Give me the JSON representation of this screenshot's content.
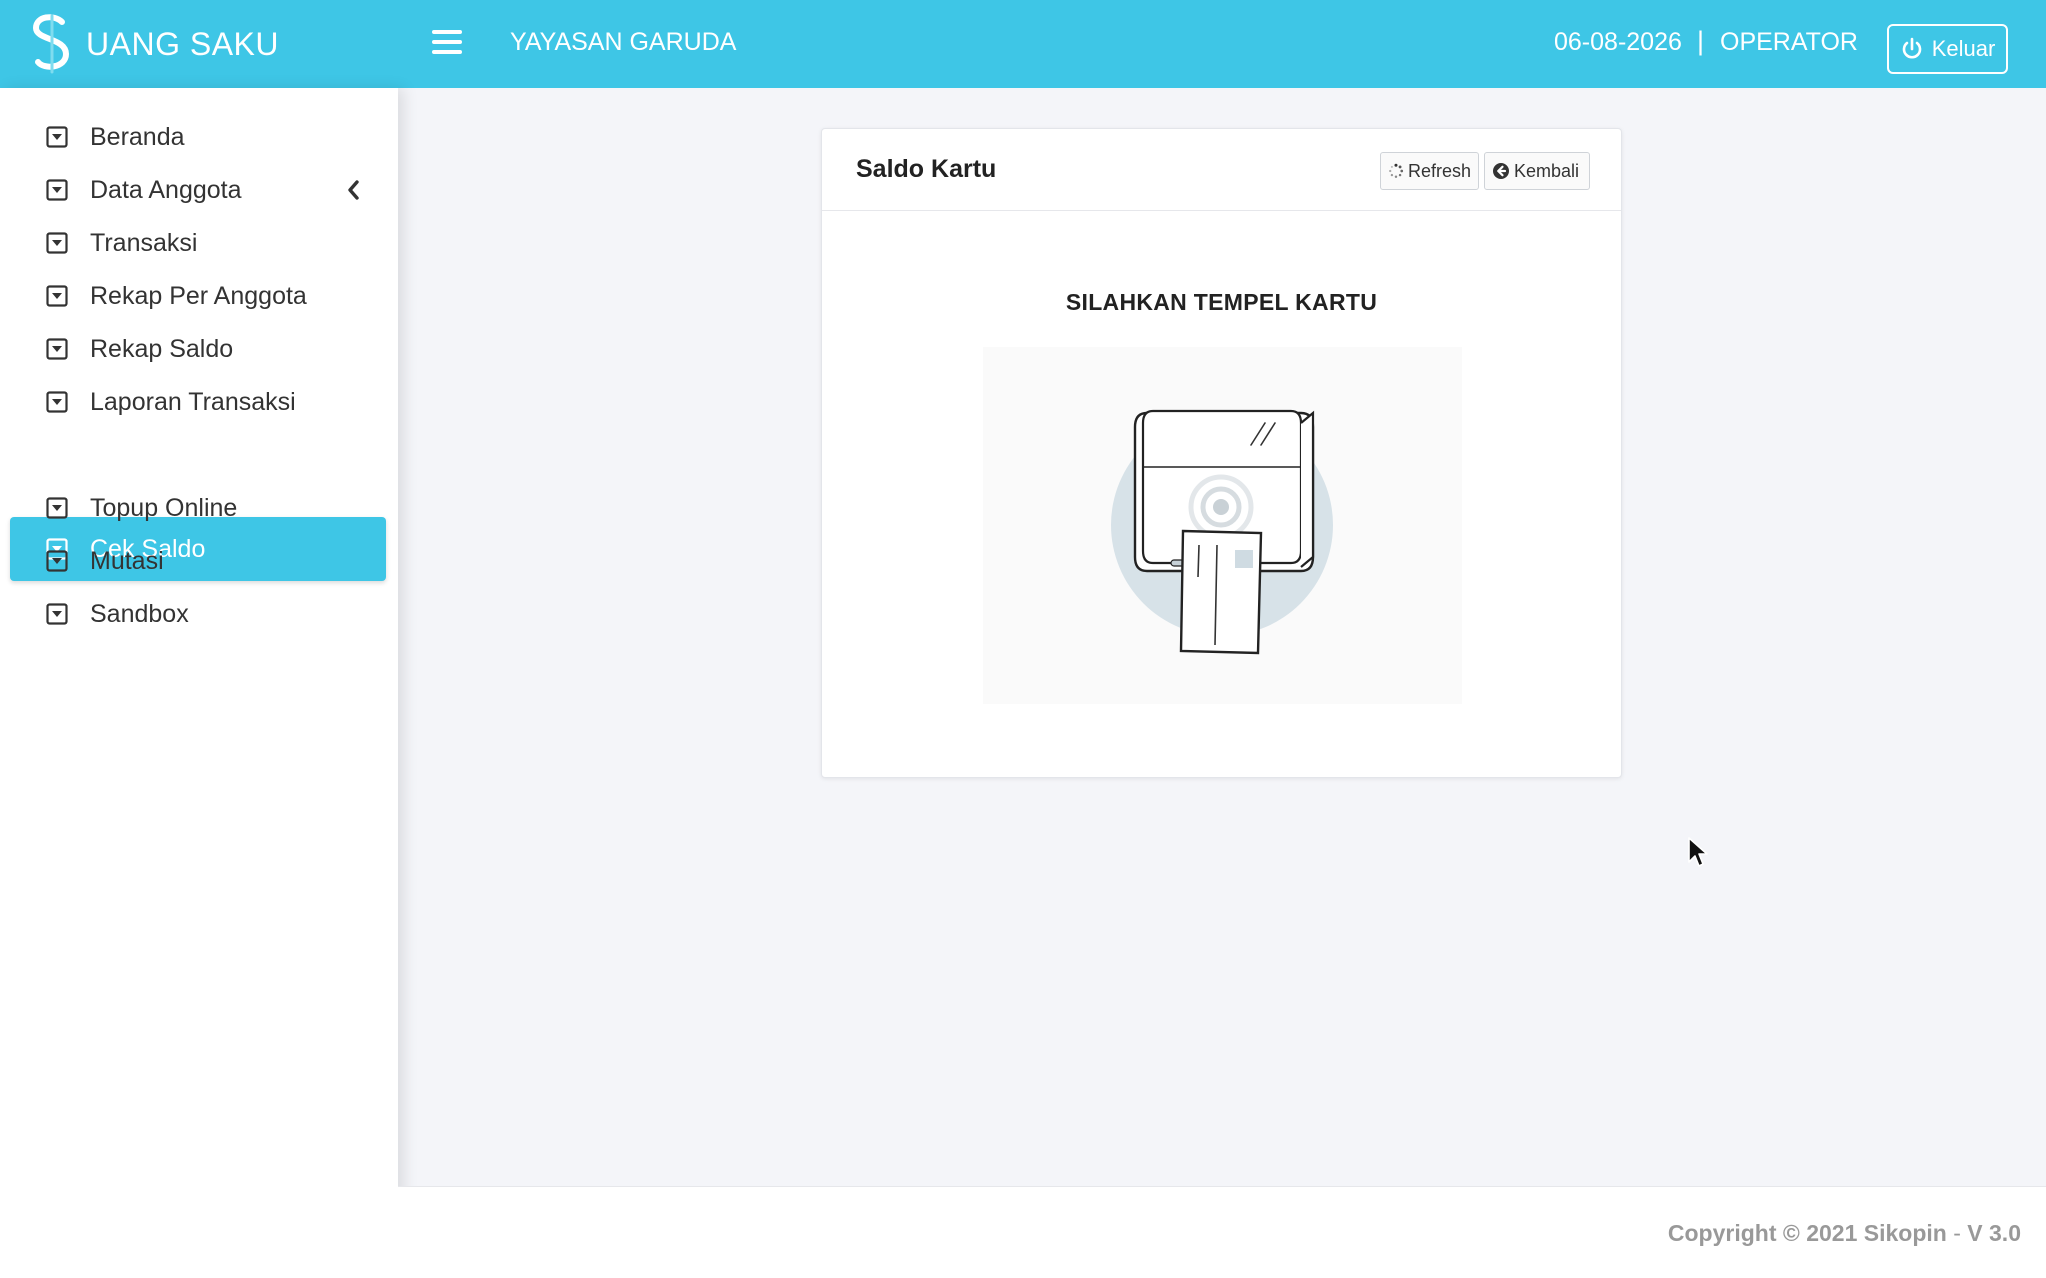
{
  "header": {
    "brand_name": "UANG SAKU",
    "org_name": "YAYASAN GARUDA",
    "date": "06-08-2026",
    "separator": "|",
    "role": "OPERATOR",
    "logout_label": "Keluar",
    "bg_color": "#3ec6e6"
  },
  "sidebar": {
    "items": [
      {
        "label": "Beranda",
        "icon": "caret-square-down-icon"
      },
      {
        "label": "Data Anggota",
        "icon": "caret-square-down-icon",
        "has_submenu": true
      },
      {
        "label": "Transaksi",
        "icon": "caret-square-down-icon"
      },
      {
        "label": "Rekap Per Anggota",
        "icon": "caret-square-down-icon"
      },
      {
        "label": "Rekap Saldo",
        "icon": "caret-square-down-icon"
      },
      {
        "label": "Laporan Transaksi",
        "icon": "caret-square-down-icon"
      },
      {
        "label": "Cek Saldo",
        "icon": "caret-square-down-icon",
        "active": true
      },
      {
        "label": "Topup Online",
        "icon": "caret-square-down-icon"
      },
      {
        "label": "Mutasi",
        "icon": "caret-square-down-icon"
      },
      {
        "label": "Sandbox",
        "icon": "caret-square-down-icon"
      }
    ],
    "active_color": "#3ec6e6"
  },
  "card": {
    "title": "Saldo Kartu",
    "refresh_label": "Refresh",
    "back_label": "Kembali",
    "prompt": "SILAHKAN TEMPEL KARTU"
  },
  "footer": {
    "copyright_prefix": "Copyright © 2021 Sikopin",
    "version_sep": " - ",
    "version": "V 3.0"
  }
}
